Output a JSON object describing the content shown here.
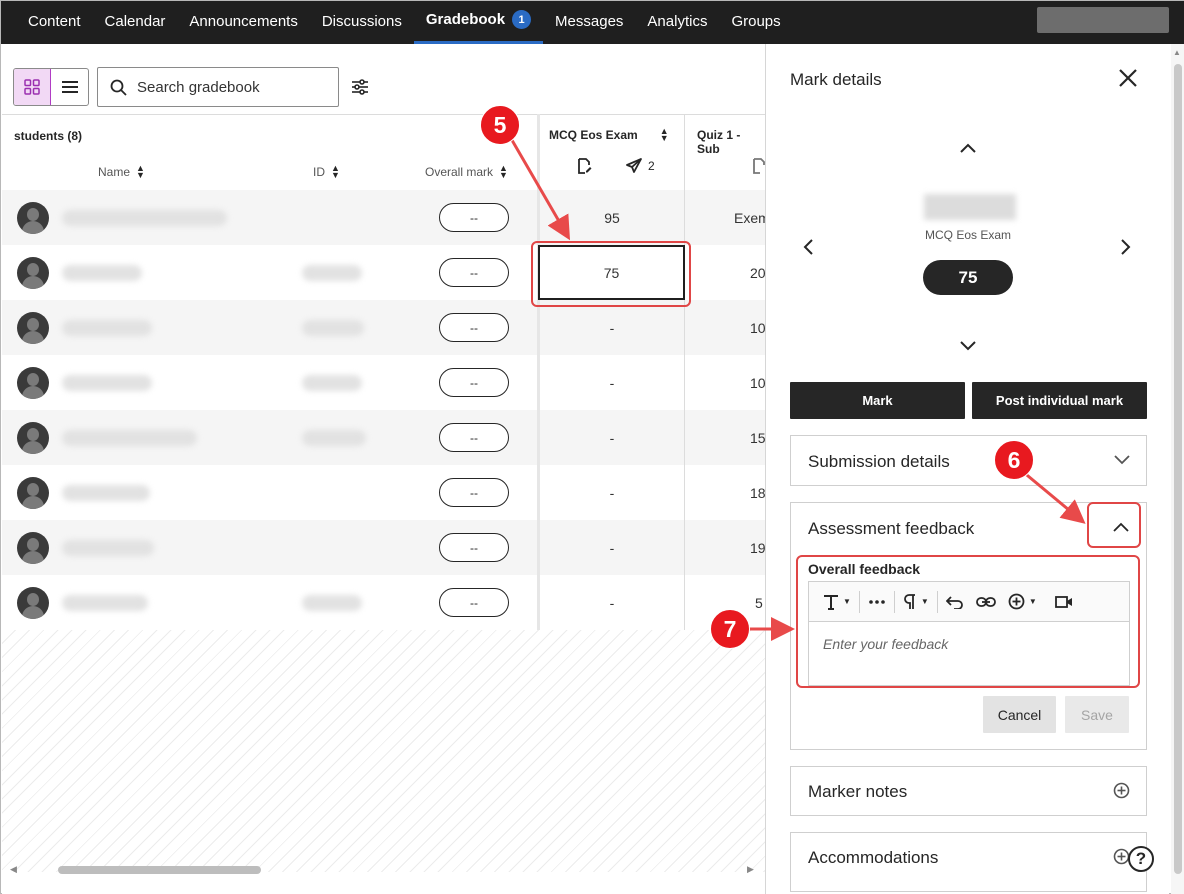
{
  "nav": {
    "tabs": [
      {
        "label": "Content"
      },
      {
        "label": "Calendar"
      },
      {
        "label": "Announcements"
      },
      {
        "label": "Discussions"
      },
      {
        "label": "Gradebook",
        "badge": "1"
      },
      {
        "label": "Messages"
      },
      {
        "label": "Analytics"
      },
      {
        "label": "Groups"
      }
    ],
    "active_tab": "Gradebook"
  },
  "toolbar": {
    "search_placeholder": "Search gradebook"
  },
  "grid": {
    "students_label": "students (8)",
    "columns": {
      "name": "Name",
      "id": "ID",
      "overall": "Overall mark",
      "exam": "MCQ Eos Exam",
      "exam_submissions": "2",
      "quiz": "Quiz 1 - Sub"
    },
    "rows": [
      {
        "overall": "--",
        "exam": "95",
        "quiz": "Exem"
      },
      {
        "overall": "--",
        "exam": "75",
        "quiz": "20"
      },
      {
        "overall": "--",
        "exam": "-",
        "quiz": "10"
      },
      {
        "overall": "--",
        "exam": "-",
        "quiz": "10"
      },
      {
        "overall": "--",
        "exam": "-",
        "quiz": "15"
      },
      {
        "overall": "--",
        "exam": "-",
        "quiz": "18"
      },
      {
        "overall": "--",
        "exam": "-",
        "quiz": "19"
      },
      {
        "overall": "--",
        "exam": "-",
        "quiz": "5"
      }
    ]
  },
  "panel": {
    "title": "Mark details",
    "exam_name": "MCQ Eos Exam",
    "mark": "75",
    "mark_button": "Mark",
    "post_button": "Post individual mark",
    "submission_details": "Submission details",
    "assessment_feedback": "Assessment feedback",
    "overall_feedback_label": "Overall feedback",
    "feedback_placeholder": "Enter your feedback",
    "cancel": "Cancel",
    "save": "Save",
    "marker_notes": "Marker notes",
    "accommodations": "Accommodations"
  },
  "annotations": {
    "step5": "5",
    "step6": "6",
    "step7": "7"
  },
  "colors": {
    "nav_bg": "#1f1f1f",
    "active_underline": "#2a6bc4",
    "annotation_red": "#e8191f",
    "dark_button": "#262626",
    "grid_toggle_active": "#f2d9f5"
  }
}
